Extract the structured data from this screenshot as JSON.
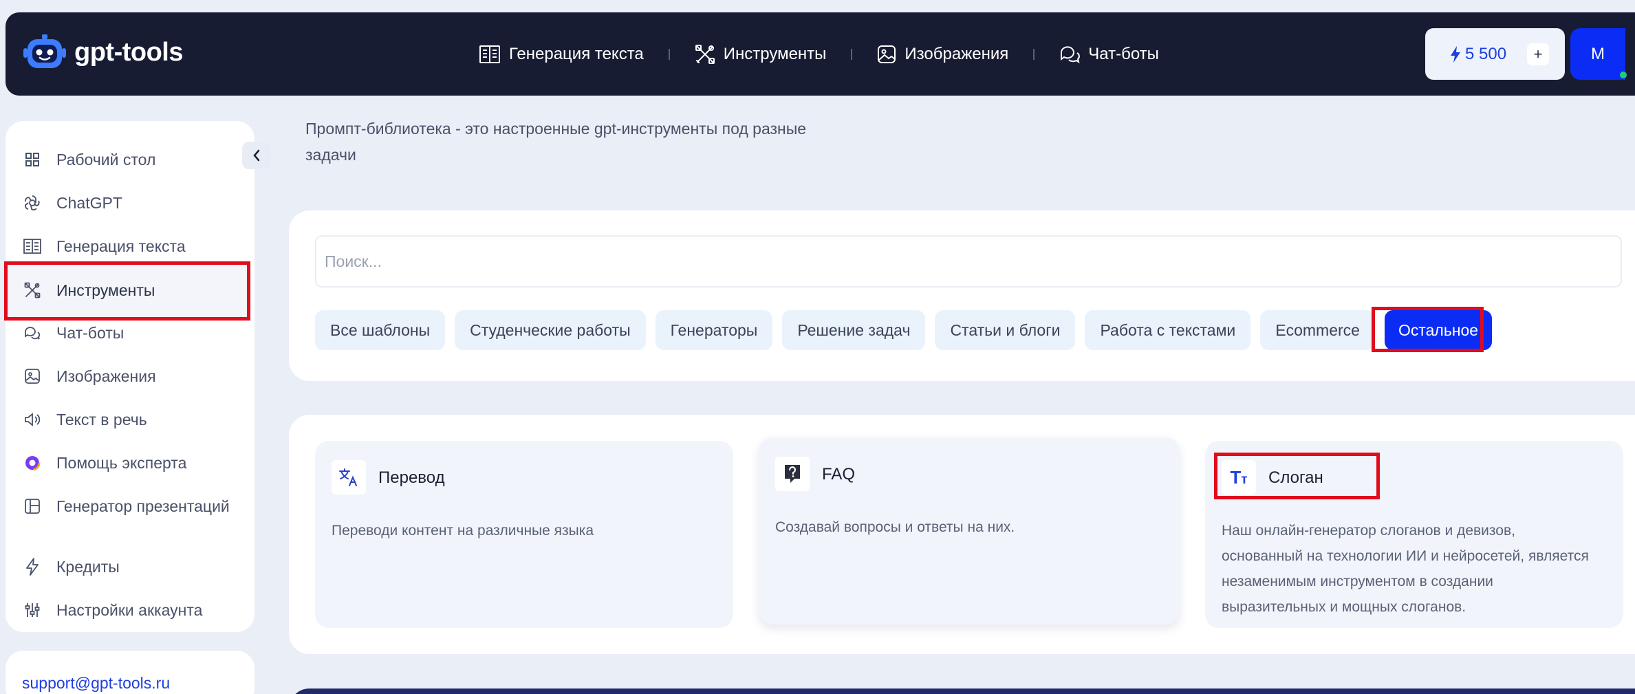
{
  "header": {
    "logo_text": "gpt-tools",
    "nav": [
      {
        "label": "Генерация текста",
        "icon": "book-icon"
      },
      {
        "label": "Инструменты",
        "icon": "tools-icon"
      },
      {
        "label": "Изображения",
        "icon": "image-icon"
      },
      {
        "label": "Чат-боты",
        "icon": "chat-icon"
      }
    ],
    "credits": "5 500",
    "credits_add": "+",
    "avatar_initial": "M"
  },
  "sidebar": {
    "items": [
      {
        "label": "Рабочий стол",
        "icon": "dashboard-icon"
      },
      {
        "label": "ChatGPT",
        "icon": "openai-icon"
      },
      {
        "label": "Генерация текста",
        "icon": "book-icon"
      },
      {
        "label": "Инструменты",
        "icon": "tools-icon",
        "active": true
      },
      {
        "label": "Чат-боты",
        "icon": "chat-icon"
      },
      {
        "label": "Изображения",
        "icon": "image-icon"
      },
      {
        "label": "Текст в речь",
        "icon": "speaker-icon"
      },
      {
        "label": "Помощь эксперта",
        "icon": "expert-icon"
      },
      {
        "label": "Генератор презентаций",
        "icon": "presentation-icon"
      },
      {
        "label": "Кредиты",
        "icon": "lightning-icon"
      },
      {
        "label": "Настройки аккаунта",
        "icon": "sliders-icon"
      }
    ],
    "support_email": "support@gpt-tools.ru"
  },
  "intro": {
    "description": "Промпт-библиотека - это настроенные gpt-инструменты под разные задачи"
  },
  "search": {
    "placeholder": "Поиск..."
  },
  "filters": [
    "Все шаблоны",
    "Студенческие работы",
    "Генераторы",
    "Решение задач",
    "Статьи и блоги",
    "Работа с текстами",
    "Ecommerce",
    "Остальное"
  ],
  "active_filter": "Остальное",
  "cards": [
    {
      "title": "Перевод",
      "description": "Переводи контент на различные языка",
      "icon": "translate-icon"
    },
    {
      "title": "FAQ",
      "description": "Создавай вопросы и ответы на них.",
      "icon": "question-icon"
    },
    {
      "title": "Слоган",
      "description": "Наш онлайн-генератор слоганов и девизов, основанный на технологии ИИ и нейросетей, является незаменимым инструментом в создании выразительных и мощных слоганов.",
      "icon": "text-size-icon"
    }
  ],
  "colors": {
    "header_bg": "#171c33",
    "accent": "#0a2cf5",
    "highlight": "#e10b1c"
  }
}
